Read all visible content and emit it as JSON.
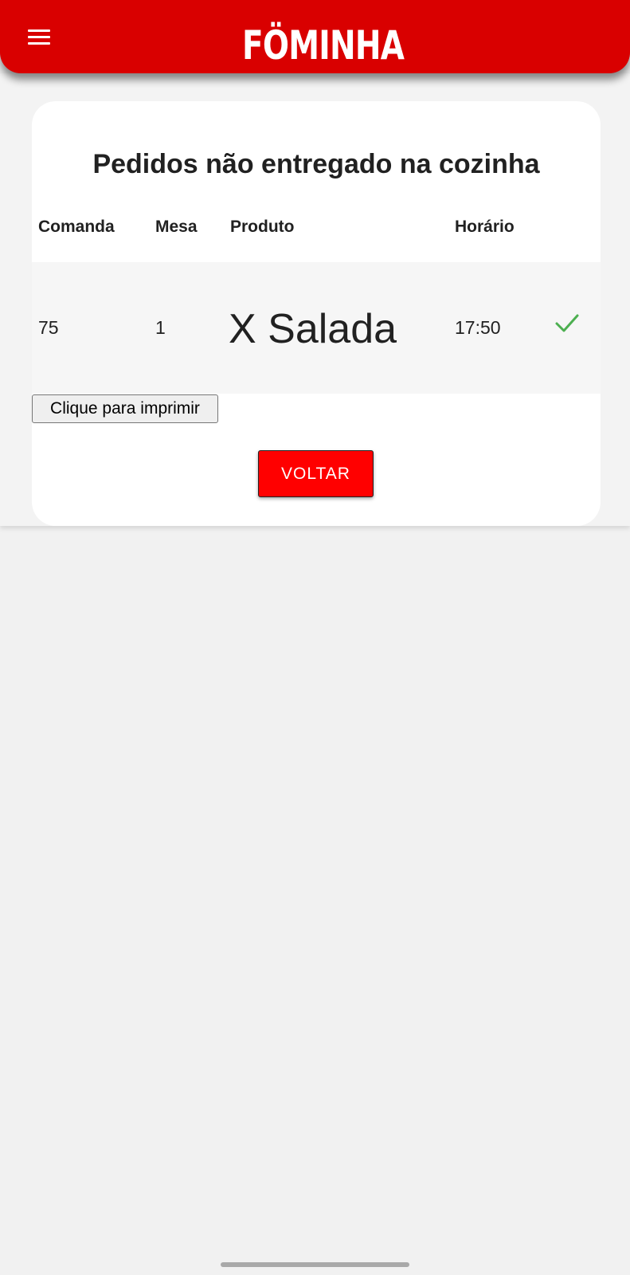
{
  "app": {
    "logo_text": "FÖMINHA",
    "brand_color": "#d90000"
  },
  "icons": {
    "menu": "hamburger-menu-icon",
    "delivered": "checkmark-icon"
  },
  "card": {
    "title": "Pedidos não entregado na cozinha"
  },
  "table": {
    "headers": {
      "comanda": "Comanda",
      "mesa": "Mesa",
      "produto": "Produto",
      "horario": "Horário"
    },
    "rows": [
      {
        "comanda": "75",
        "mesa": "1",
        "produto": "X Salada",
        "horario": "17:50",
        "status_color": "#4caf50"
      }
    ]
  },
  "actions": {
    "print_label": "Clique para imprimir",
    "back_label": "VOLTAR",
    "back_color": "#ff0000"
  }
}
